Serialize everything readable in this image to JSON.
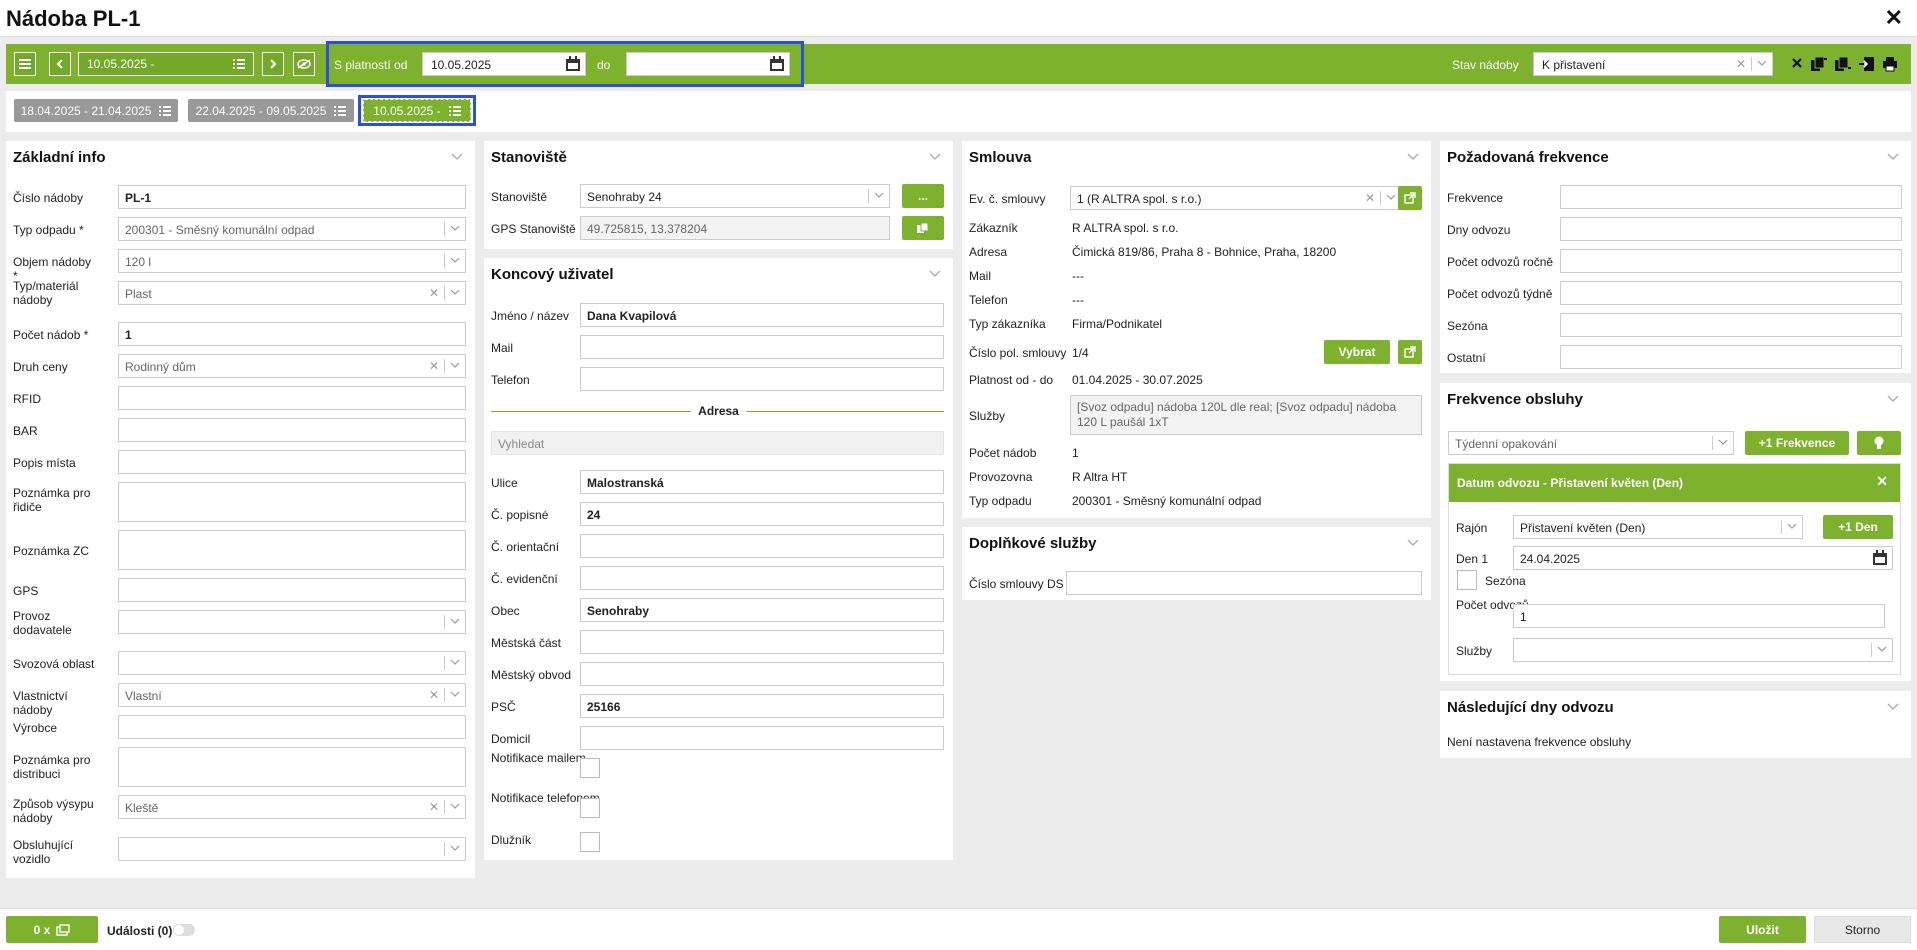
{
  "window": {
    "title": "Nádoba PL-1"
  },
  "toolbar": {
    "version_label": "10.05.2025 -",
    "valid_from_label": "S platností od",
    "valid_from": "10.05.2025",
    "to_label": "do",
    "to_value": "",
    "status_label": "Stav nádoby",
    "status_value": "K přistavení"
  },
  "tabs": [
    {
      "label": "18.04.2025 - 21.04.2025"
    },
    {
      "label": "22.04.2025 - 09.05.2025"
    },
    {
      "label": "10.05.2025 -"
    }
  ],
  "basic": {
    "title": "Základní info",
    "fields": [
      {
        "label": "Číslo nádoby",
        "value": "PL-1"
      },
      {
        "label": "Typ odpadu *",
        "value": "200301 - Směsný komunální odpad"
      },
      {
        "label": "Objem nádoby *",
        "value": "120 l"
      },
      {
        "label": "Typ/materiál nádoby",
        "value": "Plast"
      },
      {
        "label": "Počet nádob *",
        "value": "1"
      },
      {
        "label": "Druh ceny",
        "value": "Rodinný dům"
      },
      {
        "label": "RFID",
        "value": ""
      },
      {
        "label": "BAR",
        "value": ""
      },
      {
        "label": "Popis místa",
        "value": ""
      },
      {
        "label": "Poznámka pro řidiče",
        "value": ""
      },
      {
        "label": "Poznámka ZC",
        "value": ""
      },
      {
        "label": "GPS",
        "value": ""
      },
      {
        "label": "Provoz dodavatele",
        "value": ""
      },
      {
        "label": "Svozová oblast",
        "value": ""
      },
      {
        "label": "Vlastnictví nádoby",
        "value": "Vlastní"
      },
      {
        "label": "Výrobce",
        "value": ""
      },
      {
        "label": "Poznámka pro distribuci",
        "value": ""
      },
      {
        "label": "Způsob výsypu nádoby",
        "value": "Kleště"
      },
      {
        "label": "Obsluhující vozidlo",
        "value": ""
      }
    ]
  },
  "site": {
    "title": "Stanoviště",
    "site_label": "Stanoviště",
    "site_value": "Senohraby 24",
    "dots": "...",
    "gps_label": "GPS Stanoviště",
    "gps_value": "49.725815, 13.378204"
  },
  "enduser": {
    "title": "Koncový uživatel",
    "name_label": "Jméno / název",
    "name_value": "Dana Kvapilová",
    "mail_label": "Mail",
    "phone_label": "Telefon",
    "address_title": "Adresa",
    "search_placeholder": "Vyhledat",
    "fields": [
      {
        "label": "Ulice",
        "value": "Malostranská"
      },
      {
        "label": "Č. popisné",
        "value": "24"
      },
      {
        "label": "Č. orientační",
        "value": ""
      },
      {
        "label": "Č. evidenční",
        "value": ""
      },
      {
        "label": "Obec",
        "value": "Senohraby"
      },
      {
        "label": "Městská část",
        "value": ""
      },
      {
        "label": "Městský obvod",
        "value": ""
      },
      {
        "label": "PSČ",
        "value": "25166"
      },
      {
        "label": "Domicil",
        "value": ""
      }
    ],
    "notif_mail": "Notifikace mailem",
    "notif_phone": "Notifikace telefonem",
    "debtor": "Dlužník"
  },
  "contract": {
    "title": "Smlouva",
    "evc_label": "Ev. č. smlouvy",
    "evc_value": "1 (R ALTRA spol. s r.o.)",
    "rows": [
      {
        "label": "Zákazník",
        "value": "R ALTRA spol. s r.o."
      },
      {
        "label": "Adresa",
        "value": "Čimická 819/86, Praha 8 - Bohnice, Praha, 18200"
      },
      {
        "label": "Mail",
        "value": "---"
      },
      {
        "label": "Telefon",
        "value": "---"
      },
      {
        "label": "Typ zákazníka",
        "value": "Firma/Podnikatel"
      }
    ],
    "pol_label": "Číslo pol. smlouvy",
    "pol_value": "1/4",
    "choose": "Vybrat",
    "validity_label": "Platnost od - do",
    "validity_value": "01.04.2025 - 30.07.2025",
    "services_label": "Služby",
    "services_value": "[Svoz odpadu] nádoba 120L dle real; [Svoz odpadu] nádoba 120 L paušál 1xT",
    "count_label": "Počet nádob",
    "count_value": "1",
    "op_label": "Provozovna",
    "op_value": "R Altra HT",
    "waste_label": "Typ odpadu",
    "waste_value": "200301 - Směsný komunální odpad"
  },
  "extra": {
    "title": "Doplňkové služby",
    "ds_label": "Číslo smlouvy DS"
  },
  "reqfreq": {
    "title": "Požadovaná frekvence",
    "fields": [
      "Frekvence",
      "Dny odvozu",
      "Počet odvozů ročně",
      "Počet odvozů týdně",
      "Sezóna",
      "Ostatní"
    ]
  },
  "servfreq": {
    "title": "Frekvence obsluhy",
    "repeat": "Týdenní opakování",
    "add_freq": "+1 Frekvence",
    "card_title": "Datum odvozu - Přistavení květen (Den)",
    "rajon_label": "Rajón",
    "rajon_value": "Přistavení květen (Den)",
    "add_day": "+1 Den",
    "day_label": "Den 1",
    "day_value": "24.04.2025",
    "season": "Sezóna",
    "count_label": "Počet odvozů",
    "count_value": "1",
    "services_label": "Služby"
  },
  "nextdays": {
    "title": "Následující dny odvozu",
    "text": "Není nastavena frekvence obsluhy"
  },
  "footer": {
    "gallery": "0 x",
    "events": "Události (0)",
    "save": "Uložit",
    "cancel": "Storno"
  }
}
